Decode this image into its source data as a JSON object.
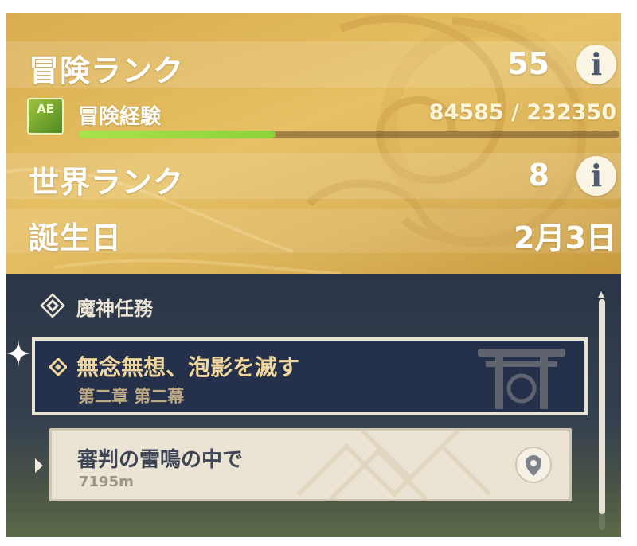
{
  "profile": {
    "adventure_rank": {
      "label": "冒険ランク",
      "value": "55"
    },
    "adventure_exp": {
      "label": "冒険経験",
      "value": "84585 / 232350",
      "progress": 0.364
    },
    "world_level": {
      "label": "世界ランク",
      "value": "8"
    },
    "birthday": {
      "label": "誕生日",
      "value": "2月3日"
    },
    "info_glyph": "i",
    "exp_icon_text": "AE"
  },
  "quests": {
    "section_title": "魔神任務",
    "main_quest": {
      "title": "無念無想、泡影を滅す",
      "chapter": "第二章 第二幕"
    },
    "current_step": {
      "title": "審判の雷鳴の中で",
      "distance": "7195m"
    }
  },
  "colors": {
    "gold_panel": "#e0b85a",
    "exp_fill": "#9ad83f",
    "quest_bg": "#25314a",
    "quest_title": "#f1d79d"
  },
  "icons": [
    "info-icon",
    "adventure-exp-icon",
    "archon-quest-icon",
    "sparkle-icon",
    "diamond-icon",
    "torii-icon",
    "map-pin-icon"
  ]
}
